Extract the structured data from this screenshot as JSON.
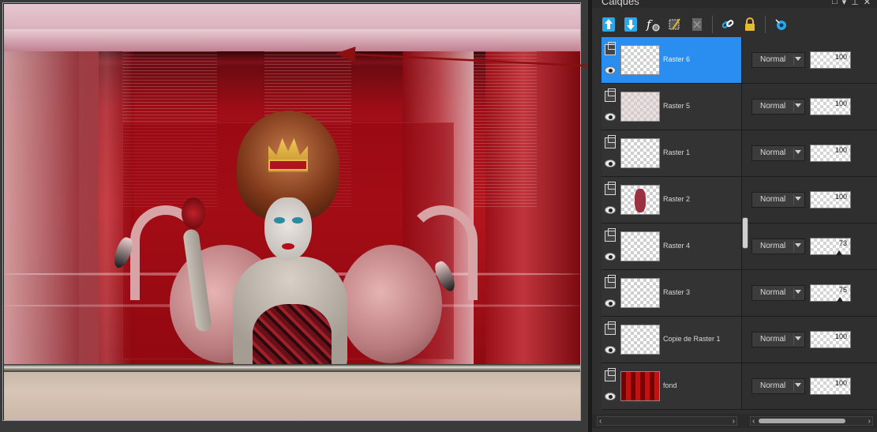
{
  "panel": {
    "title": "Calques",
    "title_buttons": [
      "□",
      "▾",
      "⊥",
      "✕"
    ]
  },
  "toolbar": {
    "tools": [
      {
        "icon": "move-layer-up-icon",
        "color": "#2aa8e8"
      },
      {
        "icon": "move-layer-down-icon",
        "color": "#2aa8e8"
      },
      {
        "icon": "layer-effects-icon",
        "color": "#ffffff"
      },
      {
        "icon": "edit-selection-icon",
        "color": "#e0b030"
      },
      {
        "icon": "delete-layer-icon",
        "color": "#777777"
      },
      {
        "icon": "link-layers-icon",
        "color": "#2aa8e8"
      },
      {
        "icon": "lock-transparency-icon",
        "color": "#e8b830"
      },
      {
        "icon": "show-hide-layers-icon",
        "color": "#2aa8e8"
      }
    ]
  },
  "layers": [
    {
      "name": "Raster 6",
      "thumb": "checker",
      "blend_mode": "Normal",
      "opacity": "100",
      "opacity_level": 100,
      "selected": true
    },
    {
      "name": "Raster 5",
      "thumb": "light-pink",
      "blend_mode": "Normal",
      "opacity": "100",
      "opacity_level": 100,
      "selected": false
    },
    {
      "name": "Raster 1",
      "thumb": "checker",
      "blend_mode": "Normal",
      "opacity": "100",
      "opacity_level": 100,
      "selected": false
    },
    {
      "name": "Raster 2",
      "thumb": "woman",
      "blend_mode": "Normal",
      "opacity": "100",
      "opacity_level": 100,
      "selected": false
    },
    {
      "name": "Raster 4",
      "thumb": "checker",
      "blend_mode": "Normal",
      "opacity": "73",
      "opacity_level": 73,
      "selected": false
    },
    {
      "name": "Raster 3",
      "thumb": "checker",
      "blend_mode": "Normal",
      "opacity": "75",
      "opacity_level": 75,
      "selected": false
    },
    {
      "name": "Copie de Raster 1",
      "thumb": "checker",
      "blend_mode": "Normal",
      "opacity": "100",
      "opacity_level": 100,
      "selected": false
    },
    {
      "name": "fond",
      "thumb": "red-pattern",
      "blend_mode": "Normal",
      "opacity": "100",
      "opacity_level": 100,
      "selected": false
    }
  ],
  "colors": {
    "selected_row": "#2a8ef0",
    "arrow": "#8b1010"
  }
}
